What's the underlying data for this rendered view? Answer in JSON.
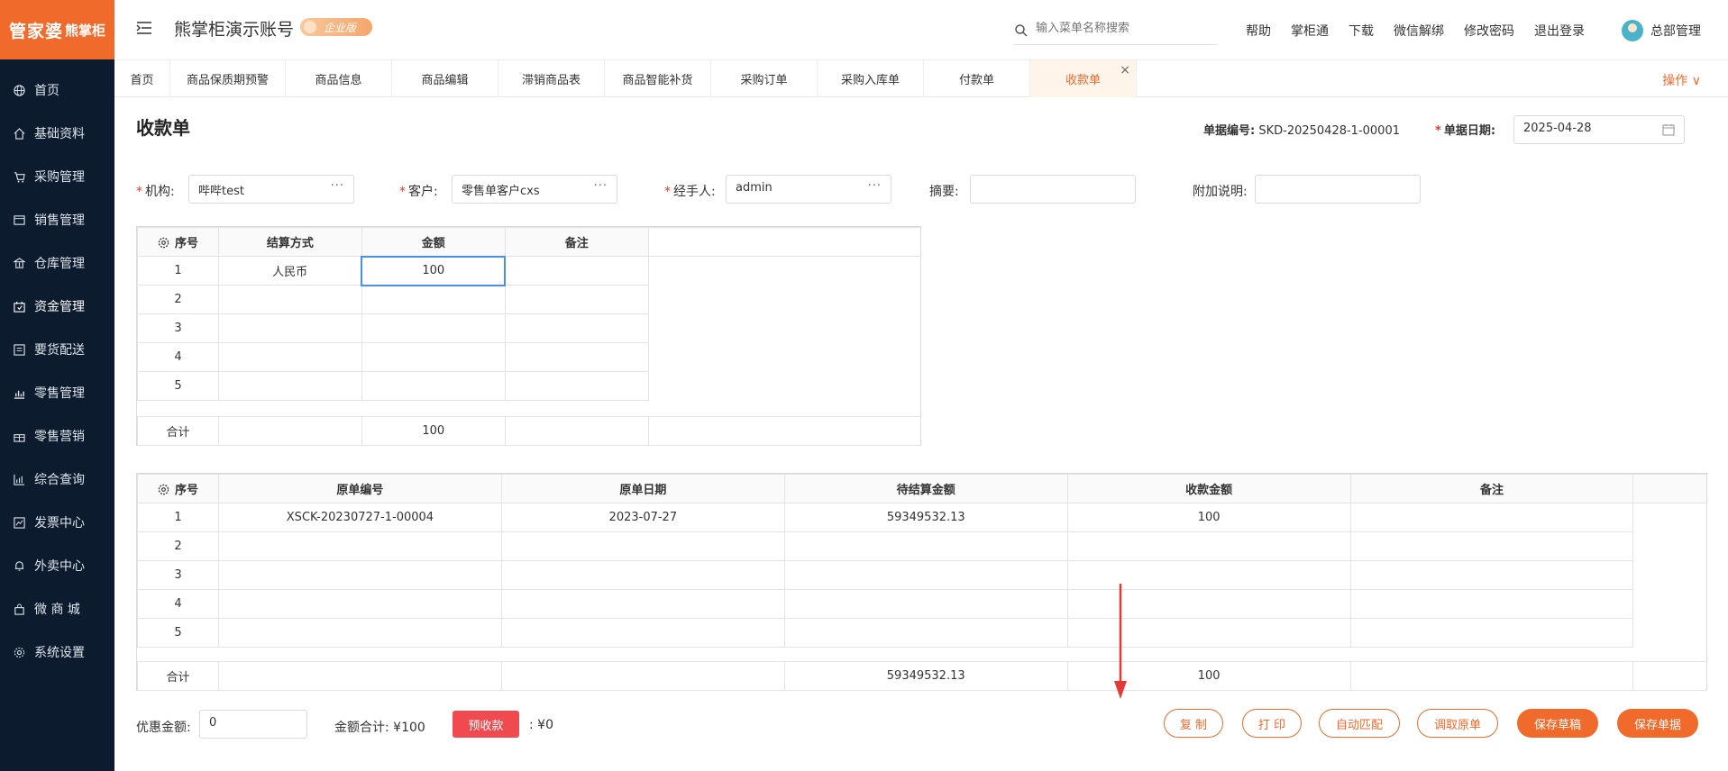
{
  "logo": {
    "part1": "管家婆",
    "part2": "熊掌柜"
  },
  "sidebar": {
    "items": [
      {
        "label": "首页",
        "icon": "globe-icon"
      },
      {
        "label": "基础资料",
        "icon": "home-icon"
      },
      {
        "label": "采购管理",
        "icon": "cart-icon"
      },
      {
        "label": "销售管理",
        "icon": "card-icon"
      },
      {
        "label": "仓库管理",
        "icon": "bank-icon"
      },
      {
        "label": "资金管理",
        "icon": "wallet-icon"
      },
      {
        "label": "要货配送",
        "icon": "list-icon"
      },
      {
        "label": "零售管理",
        "icon": "chart-icon"
      },
      {
        "label": "零售营销",
        "icon": "gift-icon"
      },
      {
        "label": "综合查询",
        "icon": "bar-chart-icon"
      },
      {
        "label": "发票中心",
        "icon": "trend-icon"
      },
      {
        "label": "外卖中心",
        "icon": "bell-icon"
      },
      {
        "label": "微 商 城",
        "icon": "bag-icon"
      },
      {
        "label": "系统设置",
        "icon": "gear-icon"
      }
    ]
  },
  "header": {
    "title": "熊掌柜演示账号",
    "badge": "企业版",
    "search_placeholder": "输入菜单名称搜索",
    "links": [
      "帮助",
      "掌柜通",
      "下载",
      "微信解绑",
      "修改密码",
      "退出登录"
    ],
    "user": "总部管理"
  },
  "tabs": [
    "首页",
    "商品保质期预警",
    "商品信息",
    "商品编辑",
    "滞销商品表",
    "商品智能补货",
    "采购订单",
    "采购入库单",
    "付款单",
    "收款单"
  ],
  "tabs_ops": "操作 ∨",
  "page": {
    "title": "收款单",
    "doc_no_label": "单据编号:",
    "doc_no": "SKD-20250428-1-00001",
    "doc_date_label": "单据日期:",
    "doc_date": "2025-04-28"
  },
  "form": {
    "org_label": "机构:",
    "org": "哔哔test",
    "customer_label": "客户:",
    "customer": "零售单客户cxs",
    "handler_label": "经手人:",
    "handler": "admin",
    "summary_label": "摘要:",
    "summary": "",
    "note_label": "附加说明:",
    "note": ""
  },
  "settle_table": {
    "headers": [
      "序号",
      "结算方式",
      "金额",
      "备注"
    ],
    "rows": [
      [
        "1",
        "人民币",
        "100",
        ""
      ],
      [
        "2",
        "",
        "",
        ""
      ],
      [
        "3",
        "",
        "",
        ""
      ],
      [
        "4",
        "",
        "",
        ""
      ],
      [
        "5",
        "",
        "",
        ""
      ]
    ],
    "total_label": "合计",
    "total_amount": "100"
  },
  "order_table": {
    "headers": [
      "序号",
      "原单编号",
      "原单日期",
      "待结算金额",
      "收款金额",
      "备注"
    ],
    "rows": [
      [
        "1",
        "XSCK-20230727-1-00004",
        "2023-07-27",
        "59349532.13",
        "100",
        ""
      ],
      [
        "2",
        "",
        "",
        "",
        "",
        ""
      ],
      [
        "3",
        "",
        "",
        "",
        "",
        ""
      ],
      [
        "4",
        "",
        "",
        "",
        "",
        ""
      ],
      [
        "5",
        "",
        "",
        "",
        "",
        ""
      ]
    ],
    "total_label": "合计",
    "total_pending": "59349532.13",
    "total_received": "100"
  },
  "footer": {
    "discount_label": "优惠金额:",
    "discount": "0",
    "sum_label": "金额合计: ¥100",
    "prepay_button": "预收款",
    "prepay_amount": ": ¥0",
    "buttons": [
      "复 制",
      "打 印",
      "自动匹配",
      "调取原单",
      "保存草稿",
      "保存单据"
    ]
  },
  "colors": {
    "accent": "#f06a2b",
    "sidebar": "#0c1b2e",
    "danger": "#f0494f"
  }
}
